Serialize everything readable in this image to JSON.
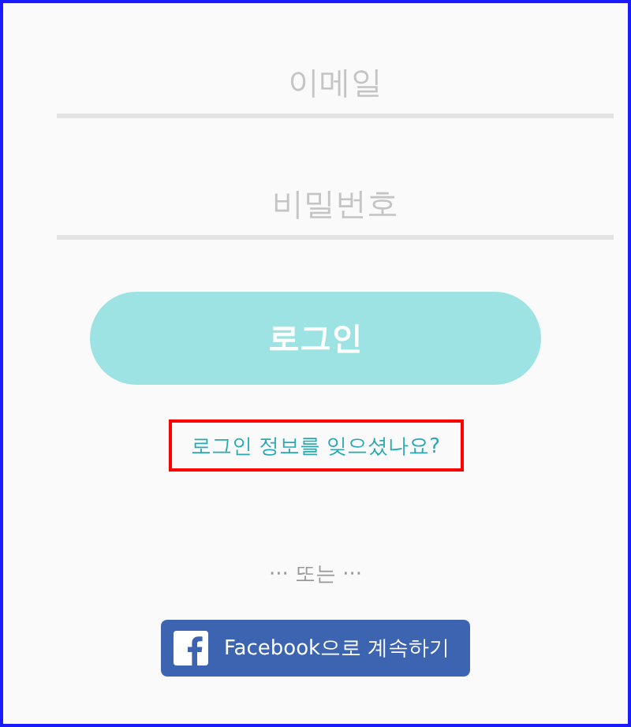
{
  "email_field": {
    "placeholder": "이메일"
  },
  "password_field": {
    "placeholder": "비밀번호"
  },
  "login_button": {
    "label": "로그인"
  },
  "forgot_link": {
    "label": "로그인 정보를 잊으셨나요?",
    "highlighted": true
  },
  "divider": {
    "label": "··· 또는 ···"
  },
  "facebook_button": {
    "label": "Facebook으로 계속하기"
  }
}
